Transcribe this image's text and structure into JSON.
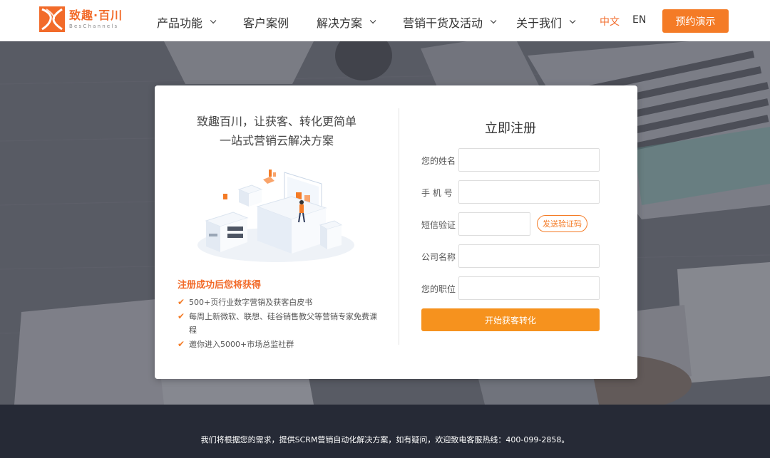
{
  "header": {
    "logo": {
      "name_cn": "致趣·百川",
      "name_en": "BesChannels"
    },
    "nav": [
      {
        "label": "产品功能",
        "has_dropdown": true
      },
      {
        "label": "客户案例",
        "has_dropdown": false
      },
      {
        "label": "解决方案",
        "has_dropdown": true
      },
      {
        "label": "营销干货及活动",
        "has_dropdown": true
      },
      {
        "label": "关于我们",
        "has_dropdown": true
      }
    ],
    "lang_cn": "中文",
    "lang_en": "EN",
    "demo_button": "预约演示"
  },
  "card": {
    "slogan_line1": "致趣百川，让获客、转化更简单",
    "slogan_line2": "一站式营销云解决方案",
    "benefits_title": "注册成功后您将获得",
    "benefits": [
      "500+页行业数字营销及获客白皮书",
      "每周上新微软、联想、硅谷销售教父等营销专家免费课程",
      "邀你进入5000+市场总监社群"
    ],
    "form": {
      "title": "立即注册",
      "fields": [
        {
          "label": "您的姓名",
          "value": ""
        },
        {
          "label": "手 机 号",
          "value": ""
        },
        {
          "label": "短信验证",
          "value": ""
        },
        {
          "label": "公司名称",
          "value": ""
        },
        {
          "label": "您的职位",
          "value": ""
        }
      ],
      "sms_button": "发送验证码",
      "submit_button": "开始获客转化"
    }
  },
  "footer": {
    "text": "我们将根据您的需求，提供SCRM营销自动化解决方案，如有疑问，欢迎致电客服热线：400-099-2858。"
  },
  "colors": {
    "brand_orange": "#f47b26",
    "submit_orange": "#f6921e",
    "footer_bg": "#262a36",
    "hero_overlay": "#5a5d66"
  }
}
